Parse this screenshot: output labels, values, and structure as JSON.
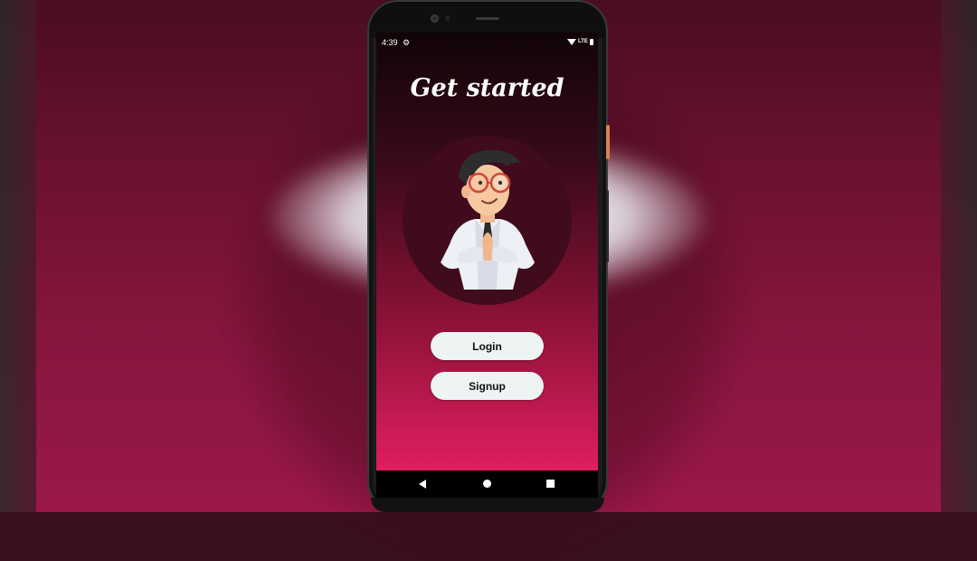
{
  "statusbar": {
    "time": "4:39",
    "network": "LTE"
  },
  "main": {
    "title": "Get started",
    "login_label": "Login",
    "signup_label": "Signup"
  },
  "colors": {
    "gradient_top": "#100408",
    "gradient_bottom": "#e01e5f",
    "button_bg": "#eef3f4",
    "avatar_circle": "#3f0b1d"
  },
  "icons": {
    "settings": "gear-icon",
    "wifi": "wifi-icon",
    "battery": "battery-icon",
    "back": "back-icon",
    "home": "home-icon",
    "recents": "recents-icon"
  }
}
